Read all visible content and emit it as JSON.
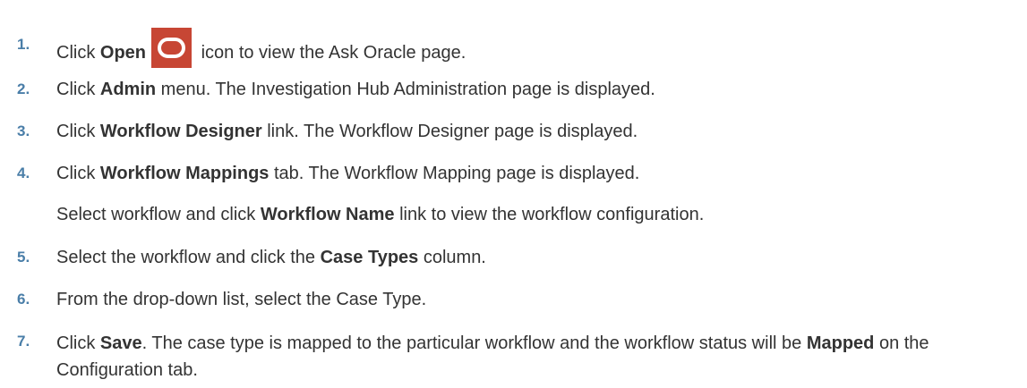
{
  "steps": [
    {
      "num": "1.",
      "before": "Click ",
      "bold": "Open",
      "after": " icon to view the Ask Oracle page.",
      "icon": "oracle-open-icon",
      "icon_color": "#C74634"
    },
    {
      "num": "2.",
      "before": "Click ",
      "bold": "Admin",
      "after": " menu. The Investigation Hub Administration page is displayed."
    },
    {
      "num": "3.",
      "before": "Click ",
      "bold": "Workflow Designer",
      "after": " link. The Workflow Designer page is displayed."
    },
    {
      "num": "4.",
      "before": "Click ",
      "bold": "Workflow Mappings",
      "after": " tab. The Workflow Mapping page is displayed.",
      "sub_before": "Select workflow and click ",
      "sub_bold": "Workflow Name",
      "sub_after": " link to view the workflow configuration."
    },
    {
      "num": "5.",
      "before": "Select the workflow and click the ",
      "bold": "Case Types",
      "after": " column."
    },
    {
      "num": "6.",
      "text": "From the drop-down list, select the Case Type."
    },
    {
      "num": "7.",
      "before": "Click ",
      "bold": "Save",
      "after": ". The case type is mapped to the particular workflow and the workflow status will be ",
      "bold2": "Mapped",
      "after2": " on the Configuration tab."
    }
  ],
  "colors": {
    "step_number": "#4A7EA8",
    "text": "#333333"
  }
}
